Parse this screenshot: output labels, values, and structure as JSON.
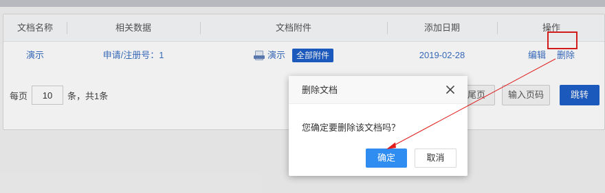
{
  "table": {
    "headers": [
      "文档名称",
      "相关数据",
      "文档附件",
      "添加日期",
      "操作"
    ],
    "rows": [
      {
        "name": "演示",
        "related": "申请/注册号：1",
        "attachment_name": "演示",
        "attachment_badge": "全部附件",
        "date": "2019-02-28",
        "edit_label": "编辑",
        "delete_label": "删除"
      }
    ]
  },
  "pager": {
    "per_page_label": "每页",
    "per_page_value": "10",
    "total_label": "条，共1条",
    "last_page_label": "尾页",
    "goto_input_label": "输入页码",
    "jump_label": "跳转"
  },
  "dialog": {
    "title": "删除文档",
    "message": "您确定要删除该文档吗？",
    "confirm_label": "确定",
    "cancel_label": "取消"
  },
  "icons": {
    "attachment": "document-icon",
    "close": "close-icon"
  },
  "colors": {
    "link": "#3a6fc4",
    "primary": "#1d5fc8",
    "dialog_primary": "#2f8cf0",
    "highlight": "#e01c1c"
  }
}
